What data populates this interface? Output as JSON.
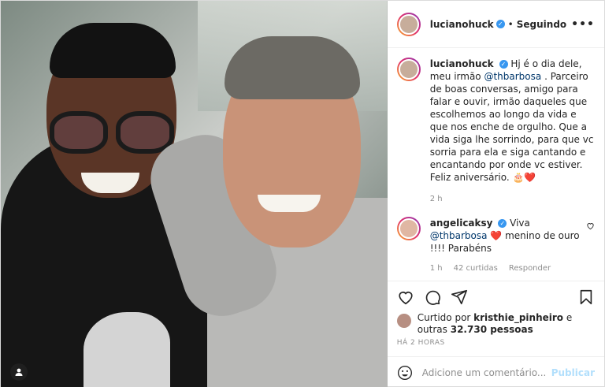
{
  "header": {
    "username": "lucianohuck",
    "follow_status": "Seguindo",
    "separator": "•"
  },
  "caption": {
    "username": "lucianohuck",
    "text_before_mention": "Hj é o dia dele, meu irmão ",
    "mention": "@thbarbosa",
    "text_after_mention": " . Parceiro de boas conversas, amigo para falar e ouvir, irmão daqueles que escolhemos ao longo da vida e que nos enche de orgulho. Que a vida siga lhe sorrindo, para que vc sorria para ela e siga cantando e encantando por onde vc estiver. Feliz aniversário. 🎂❤️",
    "time": "2 h"
  },
  "reply": {
    "username": "angelicaksy",
    "text_before_mention": " Viva ",
    "mention": "@thbarbosa",
    "text_after_mention": " ❤️ menino de ouro !!!! Parabéns",
    "time": "1 h",
    "likes": "42 curtidas",
    "reply_label": "Responder"
  },
  "likes": {
    "prefix": "Curtido por ",
    "liker": "kristhie_pinheiro",
    "middle": " e outras ",
    "count": "32.730 pessoas"
  },
  "post_time": "HÁ 2 HORAS",
  "add_comment": {
    "placeholder": "Adicione um comentário...",
    "post_label": "Publicar"
  },
  "icons": [
    "heart-icon",
    "comment-icon",
    "share-icon",
    "bookmark-icon",
    "emoji-icon",
    "tag-user-icon",
    "more-options-icon",
    "verified-icon"
  ],
  "colors": {
    "verified": "#3897f0",
    "link": "#00376b",
    "publish_disabled": "#b2dffc",
    "heart": "#ed4956"
  }
}
